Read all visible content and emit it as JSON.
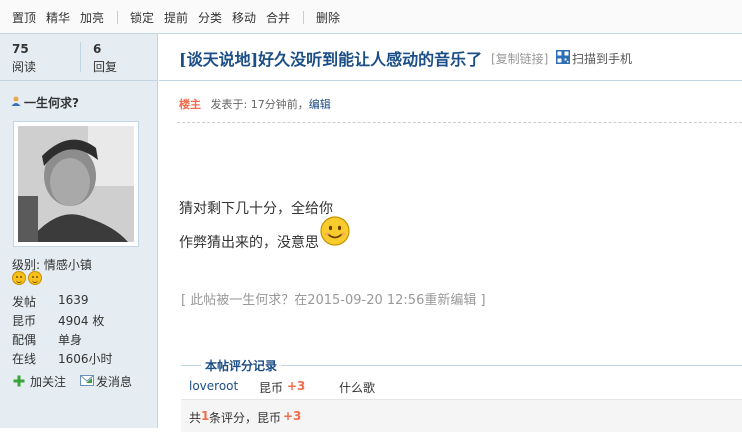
{
  "toolbar": {
    "items": [
      "置顶",
      "精华",
      "加亮",
      "锁定",
      "提前",
      "分类",
      "移动",
      "合并",
      "删除"
    ]
  },
  "stats": {
    "views": "75",
    "views_label": "阅读",
    "replies": "6",
    "replies_label": "回复"
  },
  "author": {
    "name": "一生何求?",
    "level_label": "级别: 情感小镇",
    "rows": [
      {
        "k": "发帖",
        "v": "1639"
      },
      {
        "k": "昆币",
        "v": "4904 枚"
      },
      {
        "k": "配偶",
        "v": "单身"
      },
      {
        "k": "在线",
        "v": "1606小时"
      }
    ],
    "follow": "加关注",
    "message": "发消息"
  },
  "thread": {
    "title": "[谈天说地]好久没听到能让人感动的音乐了",
    "copy_link": "[复制链接]",
    "scan": "扫描到手机"
  },
  "post": {
    "floor": "楼主",
    "posted": "发表于: 17分钟前，",
    "edit": "编辑",
    "line1": "猜对剩下几十分，全给你",
    "line2": "作弊猜出来的，没意思",
    "edited_note": "[ 此帖被一生何求？在2015-09-20 12:56重新编辑 ]"
  },
  "rating": {
    "title": "本帖评分记录",
    "user": "loveroot",
    "currency": "昆币",
    "amount": "+3",
    "reason": "什么歌",
    "sum_prefix": "共",
    "sum_count": "1",
    "sum_mid": "条评分，昆币",
    "sum_amount": "+3"
  },
  "colors": {
    "link": "#1c4e87",
    "accent": "#f26c4f",
    "sidebar_bg": "#e5edf2",
    "border": "#c2d5e3"
  }
}
